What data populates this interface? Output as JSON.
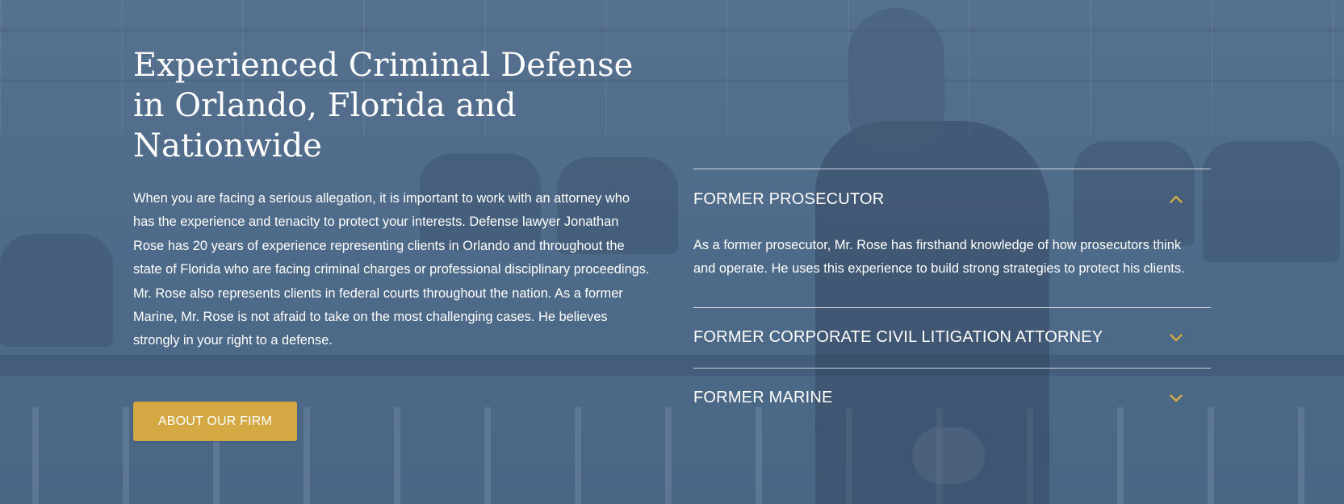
{
  "hero": {
    "heading": "Experienced Criminal Defense in Orlando, Florida and Nationwide",
    "intro": "When you are facing a serious allegation, it is important to work with an attorney who has the experience and tenacity to protect your interests. Defense lawyer Jonathan Rose has 20 years of experience representing clients in Orlando and throughout the state of Florida who are facing criminal charges or professional disciplinary proceedings. Mr. Rose also represents clients in federal courts throughout the nation. As a former Marine, Mr. Rose is not afraid to take on the most challenging cases. He believes strongly in your right to a defense.",
    "cta_label": "About Our Firm"
  },
  "accordion": {
    "items": [
      {
        "title": "Former Prosecutor",
        "expanded": true,
        "icon": "chevron-up-icon",
        "body": "As a former prosecutor, Mr. Rose has firsthand knowledge of how prosecutors think and operate. He uses this experience to build strong strategies to protect his clients."
      },
      {
        "title": "Former Corporate Civil Litigation Attorney",
        "expanded": false,
        "icon": "chevron-down-icon"
      },
      {
        "title": "Former Marine",
        "expanded": false,
        "icon": "chevron-down-icon"
      }
    ]
  },
  "colors": {
    "overlay": "#4f6b8a",
    "accent_gold": "#d4a944",
    "text": "#ffffff",
    "divider": "#ffffff"
  }
}
